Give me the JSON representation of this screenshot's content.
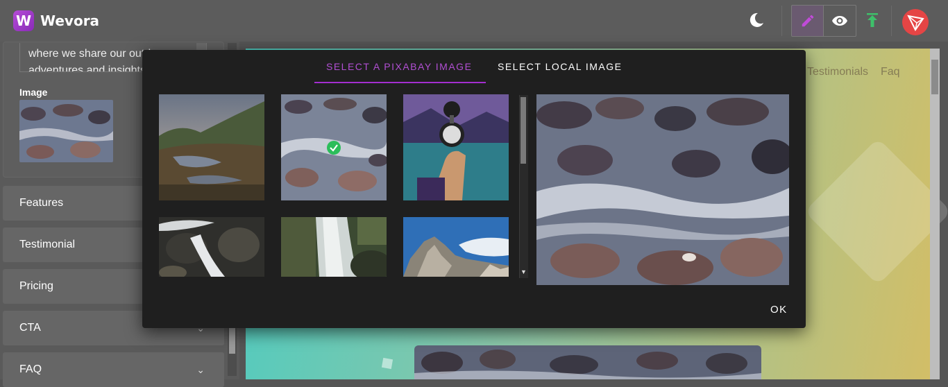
{
  "app": {
    "title": "Wevora",
    "logo_letter": "W"
  },
  "header": {
    "icons": [
      "moon-icon",
      "pencil-icon",
      "eye-icon",
      "upload-icon",
      "avatar-icon"
    ],
    "accent": "#a42ed0"
  },
  "sidebar": {
    "textarea_value": "where we share our outdoor adventures and insights",
    "image_label": "Image",
    "sections": [
      {
        "label": "Features"
      },
      {
        "label": "Testimonial"
      },
      {
        "label": "Pricing"
      },
      {
        "label": "CTA"
      },
      {
        "label": "FAQ"
      }
    ]
  },
  "preview": {
    "nav": [
      "Testimonials",
      "Faq"
    ]
  },
  "modal": {
    "tabs": [
      {
        "label": "SELECT A PIXABAY IMAGE",
        "active": true
      },
      {
        "label": "SELECT LOCAL IMAGE",
        "active": false
      }
    ],
    "images": [
      {
        "name": "mountain-meadow-image"
      },
      {
        "name": "river-rocks-image",
        "selected": true
      },
      {
        "name": "compass-hand-image"
      },
      {
        "name": "waterfall-rocks-image"
      },
      {
        "name": "forest-waterfall-image"
      },
      {
        "name": "mountain-peak-image"
      }
    ],
    "ok_label": "OK"
  }
}
